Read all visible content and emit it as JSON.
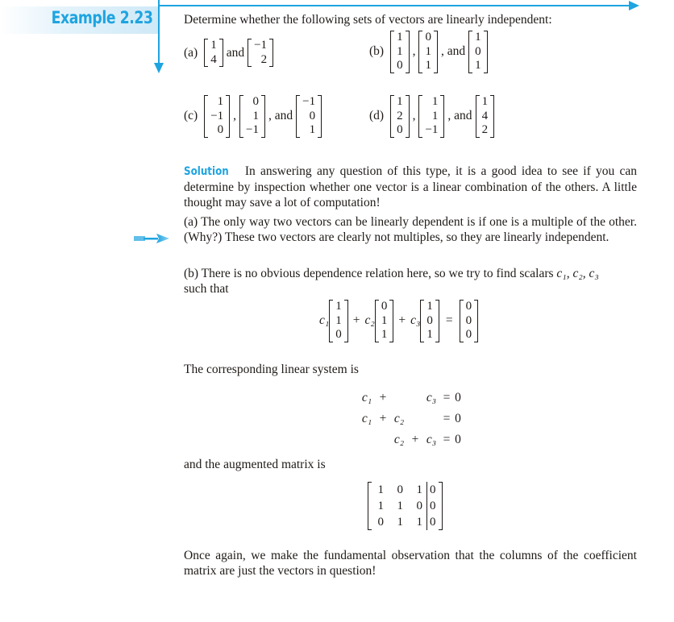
{
  "header": {
    "label": "Example 2.23",
    "accent_color": "#1ea4e0",
    "intro": "Determine whether the following sets of vectors are linearly independent:"
  },
  "problems": [
    {
      "label": "(a)",
      "vectors": [
        [
          "1",
          "4"
        ],
        [
          "−1",
          "2"
        ]
      ],
      "joiners": [
        "and"
      ]
    },
    {
      "label": "(b)",
      "vectors": [
        [
          "1",
          "1",
          "0"
        ],
        [
          "0",
          "1",
          "1"
        ],
        [
          "1",
          "0",
          "1"
        ]
      ],
      "joiners": [
        ",",
        ", and"
      ]
    },
    {
      "label": "(c)",
      "vectors": [
        [
          "1",
          "−1",
          "0"
        ],
        [
          "0",
          "1",
          "−1"
        ],
        [
          "−1",
          "0",
          "1"
        ]
      ],
      "joiners": [
        ",",
        ", and"
      ]
    },
    {
      "label": "(d)",
      "vectors": [
        [
          "1",
          "2",
          "0"
        ],
        [
          "1",
          "1",
          "−1"
        ],
        [
          "1",
          "4",
          "2"
        ]
      ],
      "joiners": [
        ",",
        ", and"
      ]
    }
  ],
  "solution": {
    "label": "Solution",
    "intro": "In answering any question of this type, it is a good idea to see if you can determine by inspection whether one vector is a linear combination of the others. A little thought may save a lot of computation!",
    "part_a": "(a) The only way two vectors can be linearly dependent is if one is a multiple of the other. (Why?) These two vectors are clearly not multiples, so they are linearly independent.",
    "part_b_text": "(b) There is no obvious dependence relation here, so we try to find scalars",
    "part_b_scalars": "c₁, c₂, c₃",
    "part_b_tail": "such that",
    "combination": {
      "coefficients": [
        "c₁",
        "c₂",
        "c₃"
      ],
      "vectors": [
        [
          "1",
          "1",
          "0"
        ],
        [
          "0",
          "1",
          "1"
        ],
        [
          "1",
          "0",
          "1"
        ]
      ],
      "result": [
        "0",
        "0",
        "0"
      ],
      "plus": "+",
      "equals": "="
    },
    "system_intro": "The corresponding linear system is",
    "system": [
      [
        "c₁",
        "+",
        "",
        "",
        "c₃",
        "=",
        "0"
      ],
      [
        "c₁",
        "+",
        "c₂",
        "",
        "",
        "=",
        "0"
      ],
      [
        "",
        "",
        "c₂",
        "+",
        "c₃",
        "=",
        "0"
      ]
    ],
    "augmented_intro": "and the augmented matrix is",
    "augmented_matrix": {
      "coefficients": [
        [
          "1",
          "0",
          "1"
        ],
        [
          "1",
          "1",
          "0"
        ],
        [
          "0",
          "1",
          "1"
        ]
      ],
      "rhs": [
        "0",
        "0",
        "0"
      ]
    },
    "conclusion": "Once again, we make the fundamental observation that the columns of the coefficient matrix are just the vectors in question!"
  },
  "icons": {
    "sidebar_arrow": "right-arrow-icon"
  }
}
